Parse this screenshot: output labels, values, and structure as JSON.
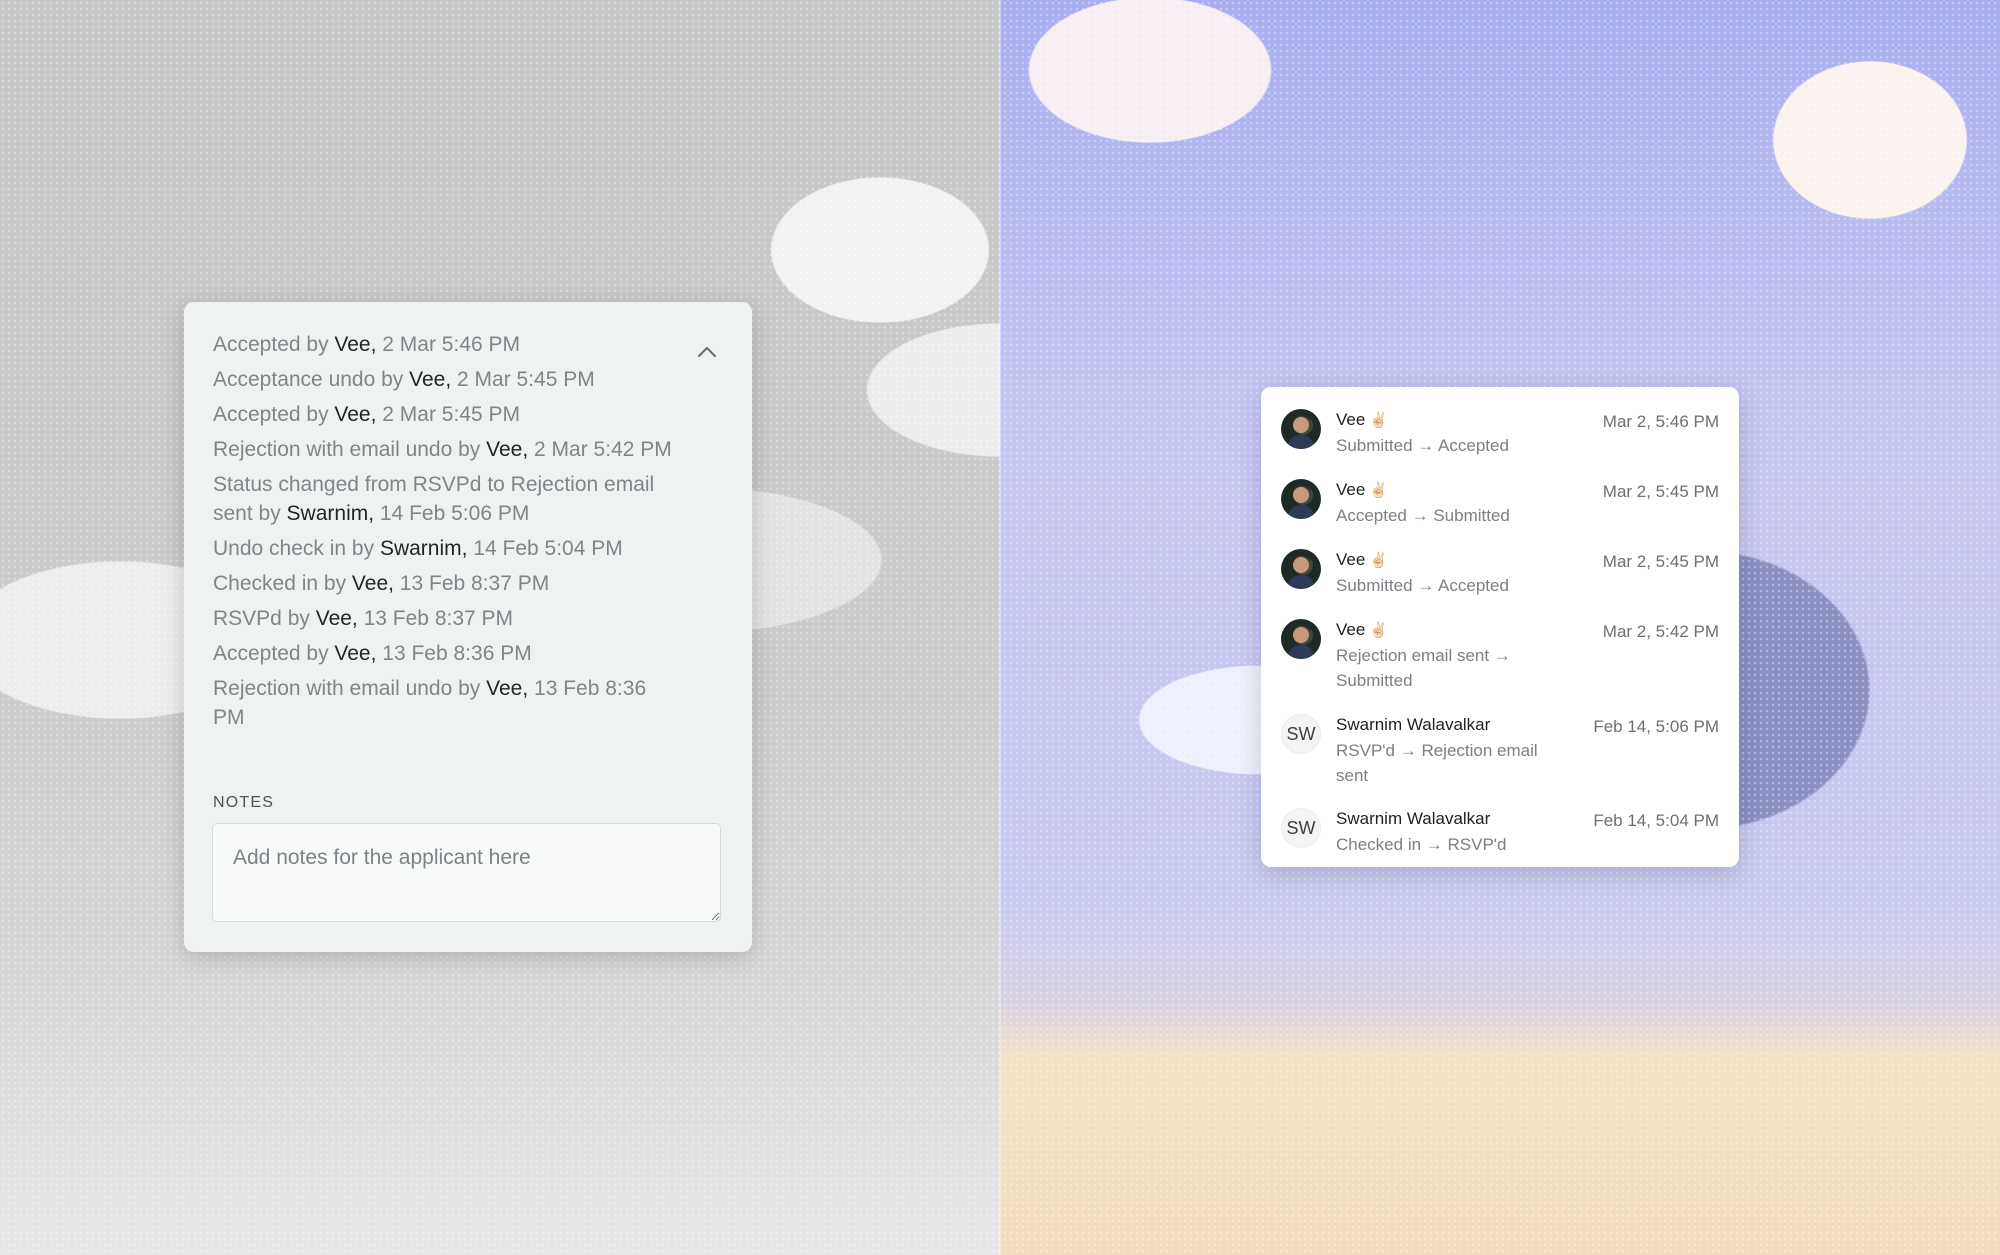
{
  "log": {
    "entries": [
      {
        "pre": "Accepted by ",
        "actor": "Vee,",
        "post": " 2 Mar 5:46 PM"
      },
      {
        "pre": "Acceptance undo by ",
        "actor": "Vee,",
        "post": " 2 Mar 5:45 PM"
      },
      {
        "pre": "Accepted by ",
        "actor": "Vee,",
        "post": " 2 Mar 5:45 PM"
      },
      {
        "pre": "Rejection with email undo by ",
        "actor": "Vee,",
        "post": " 2 Mar 5:42 PM"
      },
      {
        "pre": "Status changed from RSVPd to Rejection email sent by ",
        "actor": "Swarnim,",
        "post": " 14 Feb 5:06 PM"
      },
      {
        "pre": "Undo check in by ",
        "actor": "Swarnim,",
        "post": " 14 Feb 5:04 PM"
      },
      {
        "pre": "Checked in by ",
        "actor": "Vee,",
        "post": " 13 Feb 8:37 PM"
      },
      {
        "pre": "RSVPd by ",
        "actor": "Vee,",
        "post": " 13 Feb 8:37 PM"
      },
      {
        "pre": "Accepted by ",
        "actor": "Vee,",
        "post": " 13 Feb 8:36 PM"
      },
      {
        "pre": "Rejection with email undo by ",
        "actor": "Vee,",
        "post": " 13 Feb 8:36 PM"
      }
    ],
    "collapse_icon": "chevron-up-icon"
  },
  "notes": {
    "label": "NOTES",
    "placeholder": "Add notes for the applicant here"
  },
  "history": {
    "entries": [
      {
        "name": "Vee",
        "emoji": "✌🏻",
        "avatar": "photo",
        "change": "Submitted → Accepted",
        "time": "Mar 2, 5:46 PM"
      },
      {
        "name": "Vee",
        "emoji": "✌🏻",
        "avatar": "photo",
        "change": "Accepted → Submitted",
        "time": "Mar 2, 5:45 PM"
      },
      {
        "name": "Vee",
        "emoji": "✌🏻",
        "avatar": "photo",
        "change": "Submitted → Accepted",
        "time": "Mar 2, 5:45 PM"
      },
      {
        "name": "Vee",
        "emoji": "✌🏻",
        "avatar": "photo",
        "change": "Rejection email sent → Submitted",
        "time": "Mar 2, 5:42 PM"
      },
      {
        "name": "Swarnim Walavalkar",
        "emoji": "",
        "avatar": "SW",
        "change": "RSVP'd → Rejection email sent",
        "time": "Feb 14, 5:06 PM"
      },
      {
        "name": "Swarnim Walavalkar",
        "emoji": "",
        "avatar": "SW",
        "change": "Checked in → RSVP'd",
        "time": "Feb 14, 5:04 PM"
      }
    ]
  }
}
